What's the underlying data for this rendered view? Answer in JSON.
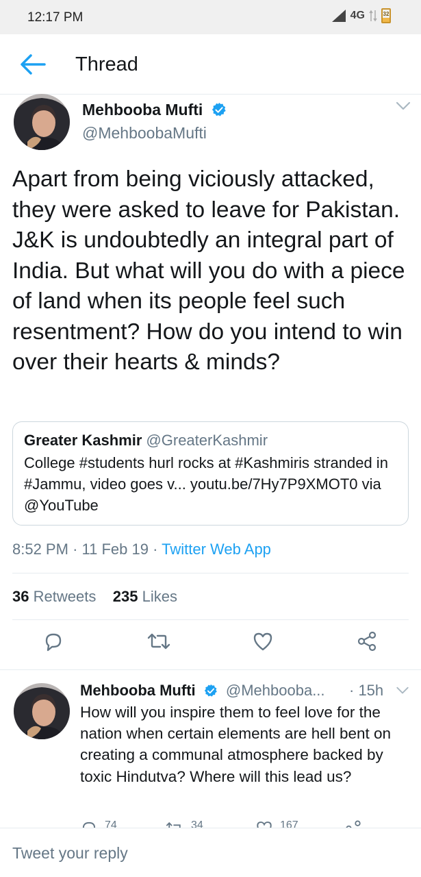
{
  "status_bar": {
    "time": "12:17 PM",
    "network": "4G",
    "battery": "32"
  },
  "header": {
    "title": "Thread"
  },
  "main_tweet": {
    "author_name": "Mehbooba Mufti",
    "author_handle": "@MehboobaMufti",
    "text": "Apart from being viciously attacked, they were asked to leave for Pakistan. J&K is undoubtedly an integral part of India. But what will you do with a piece of land when its people feel such resentment? How do you intend to win over their hearts & minds?",
    "quoted": {
      "name": "Greater Kashmir",
      "handle": "@GreaterKashmir",
      "text": "College #students hurl rocks at #Kashmiris stranded in #Jammu, video goes v... youtu.be/7Hy7P9XMOT0 via @YouTube"
    },
    "time": "8:52 PM",
    "date": "11 Feb 19",
    "separator": "·",
    "source": "Twitter Web App",
    "retweets_count": "36",
    "retweets_label": "Retweets",
    "likes_count": "235",
    "likes_label": "Likes"
  },
  "reply_tweet": {
    "author_name": "Mehbooba Mufti",
    "author_handle": "@Mehbooba...",
    "time": "· 15h",
    "text": "How will you inspire them to feel love for the nation when certain elements are hell bent on creating a communal atmosphere backed by toxic Hindutva? Where will this lead us?",
    "replies": "74",
    "retweets": "34",
    "likes": "167"
  },
  "composer": {
    "placeholder": "Tweet your reply"
  },
  "colors": {
    "accent": "#1da1f2",
    "secondary_text": "#657786",
    "border": "#e6ecf0"
  }
}
